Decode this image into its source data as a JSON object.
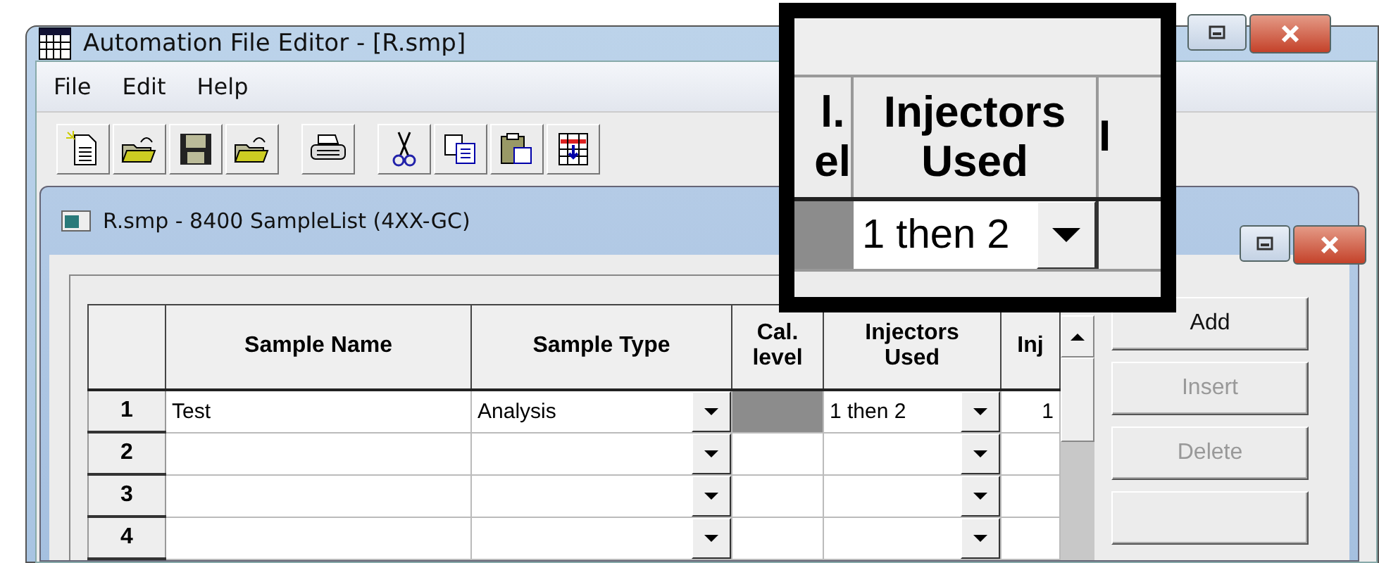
{
  "window": {
    "title": "Automation File Editor - [R.smp]"
  },
  "menu": [
    "File",
    "Edit",
    "Help"
  ],
  "toolbar_groups": [
    [
      {
        "kind": "new"
      },
      {
        "kind": "open"
      },
      {
        "kind": "save"
      },
      {
        "kind": "open"
      }
    ],
    [
      {
        "kind": "print"
      }
    ],
    [
      {
        "kind": "cut"
      },
      {
        "kind": "copy"
      },
      {
        "kind": "paste"
      },
      {
        "kind": "grid"
      }
    ]
  ],
  "child_window": {
    "title": "R.smp - 8400 SampleList (4XX-GC)"
  },
  "table": {
    "columns": [
      {
        "label": "Sample Name",
        "kind": "text"
      },
      {
        "label": "Sample Type",
        "kind": "dropdown"
      },
      {
        "label": "Cal.\nlevel",
        "kind": "text"
      },
      {
        "label": "Injectors\nUsed",
        "kind": "dropdown"
      },
      {
        "label": "Inj",
        "kind": "number"
      }
    ],
    "rows": [
      {
        "number": "1",
        "cells": [
          {
            "value": "Test"
          },
          {
            "value": "Analysis"
          },
          {
            "disabled": true
          },
          {
            "value": "1 then 2"
          },
          {
            "value": "1"
          }
        ]
      },
      {
        "number": "2",
        "cells": [
          {},
          {},
          {
            "disabled": false
          },
          {},
          {}
        ]
      },
      {
        "number": "3",
        "cells": [
          {},
          {},
          {
            "disabled": false
          },
          {},
          {}
        ]
      },
      {
        "number": "4",
        "cells": [
          {},
          {},
          {
            "disabled": false
          },
          {},
          {}
        ]
      }
    ]
  },
  "buttons": [
    {
      "label": "Add",
      "disabled": false
    },
    {
      "label": "Insert",
      "disabled": true
    },
    {
      "label": "Delete",
      "disabled": true
    }
  ],
  "zoom_callout": {
    "headers": [
      "l.\nel",
      "Injectors\nUsed",
      "I"
    ],
    "row_value": "1 then 2",
    "left_cell_disabled": true
  }
}
